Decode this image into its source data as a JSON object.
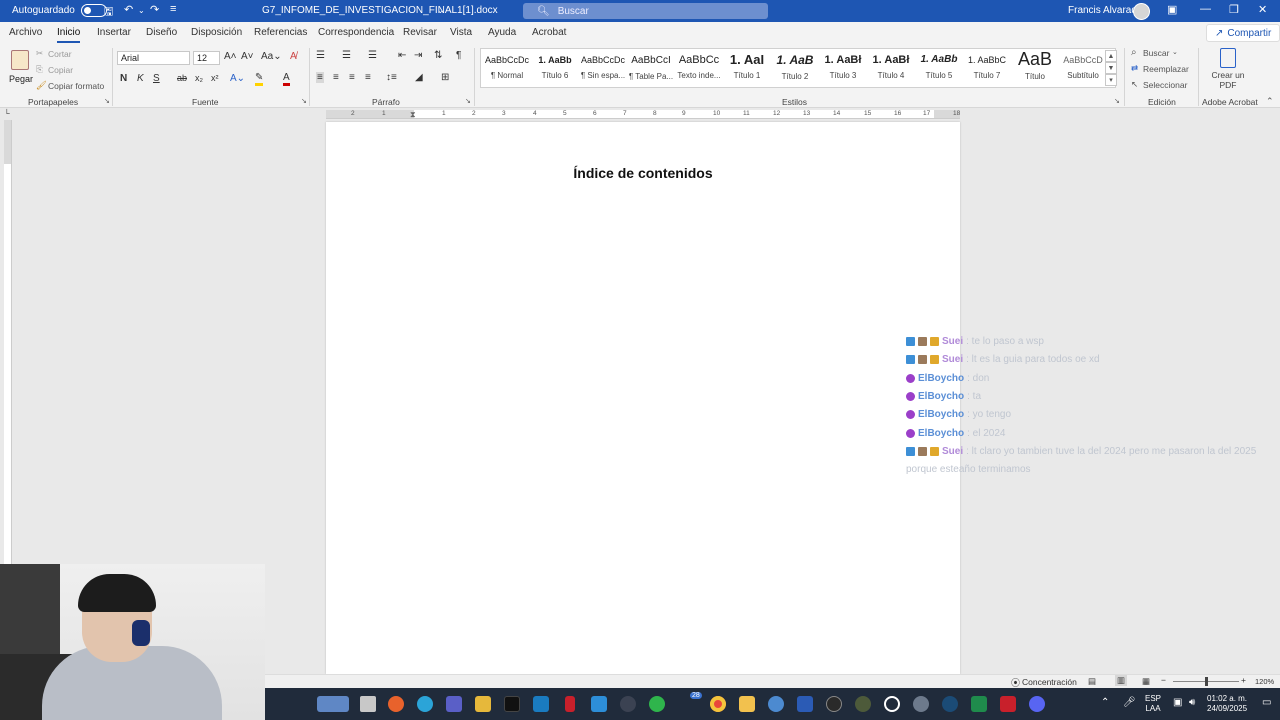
{
  "titlebar": {
    "autosave_label": "Autoguardado",
    "doc_title": "G7_INFOME_DE_INVESTIGACION_FINAL1[1].docx",
    "search_placeholder": "Buscar",
    "user_name": "Francis Alvarado"
  },
  "menu": {
    "tabs": [
      "Archivo",
      "Inicio",
      "Insertar",
      "Diseño",
      "Disposición",
      "Referencias",
      "Correspondencia",
      "Revisar",
      "Vista",
      "Ayuda",
      "Acrobat"
    ],
    "active": "Inicio",
    "share_label": "Compartir"
  },
  "ribbon": {
    "clipboard": {
      "paste": "Pegar",
      "cut": "Cortar",
      "copy": "Copiar",
      "format_painter": "Copiar formato",
      "label": "Portapapeles"
    },
    "font": {
      "name": "Arial",
      "size": "12",
      "label": "Fuente",
      "bold": "N",
      "italic": "K",
      "underline": "S",
      "strike": "ab"
    },
    "paragraph": {
      "label": "Párrafo"
    },
    "styles": {
      "label": "Estilos",
      "items": [
        {
          "sample": "AaBbCcDc",
          "name": "¶ Normal"
        },
        {
          "sample": "1. AaBb",
          "name": "Título 6"
        },
        {
          "sample": "AaBbCcDc",
          "name": "¶ Sin espa..."
        },
        {
          "sample": "AaBbCcI",
          "name": "¶ Table Pa..."
        },
        {
          "sample": "AaBbCc",
          "name": "Texto inde..."
        },
        {
          "sample": "1. AaI",
          "name": "Título 1"
        },
        {
          "sample": "1. AaB",
          "name": "Título 2"
        },
        {
          "sample": "1. AaBł",
          "name": "Título 3"
        },
        {
          "sample": "1. AaBł",
          "name": "Título 4"
        },
        {
          "sample": "1. AaBb",
          "name": "Título 5"
        },
        {
          "sample": "1. AaBbC",
          "name": "Título 7"
        },
        {
          "sample": "AaB",
          "name": "Título"
        },
        {
          "sample": "AaBbCcD",
          "name": "Subtítulo"
        }
      ]
    },
    "editing": {
      "find": "Buscar",
      "replace": "Reemplazar",
      "select": "Seleccionar",
      "label": "Edición"
    },
    "acrobat": {
      "create_pdf": "Crear un PDF",
      "label": "Adobe Acrobat"
    }
  },
  "ruler": {
    "numbers": [
      "2",
      "1",
      "1",
      "2",
      "3",
      "4",
      "5",
      "6",
      "7",
      "8",
      "9",
      "10",
      "11",
      "12",
      "13",
      "14",
      "15",
      "16",
      "17",
      "18"
    ]
  },
  "document": {
    "heading": "Índice de contenidos"
  },
  "chat": [
    {
      "user": "Suei",
      "message": ": te lo paso a wsp",
      "user_color": "#b08ad8"
    },
    {
      "user": "Suei",
      "message": ": lt es la guia para todos oe xd",
      "user_color": "#b08ad8"
    },
    {
      "user": "ElBoycho",
      "message": ": don",
      "user_color": "#5b8fd6"
    },
    {
      "user": "ElBoycho",
      "message": ": ta",
      "user_color": "#5b8fd6"
    },
    {
      "user": "ElBoycho",
      "message": ": yo tengo",
      "user_color": "#5b8fd6"
    },
    {
      "user": "ElBoycho",
      "message": ": el 2024",
      "user_color": "#5b8fd6"
    },
    {
      "user": "Suei",
      "message": ": lt claro yo tambien tuve la del 2024 pero me pasaron la del 2025",
      "user_color": "#b08ad8"
    }
  ],
  "chat_continuation": "porque esteaño terminamos",
  "statusbar": {
    "focus": "Concentración",
    "zoom": "120%"
  },
  "taskbar": {
    "language": "ESP",
    "layout": "LAA",
    "time": "01:02 a. m.",
    "date": "24/09/2025",
    "chrome_badge": "28"
  }
}
